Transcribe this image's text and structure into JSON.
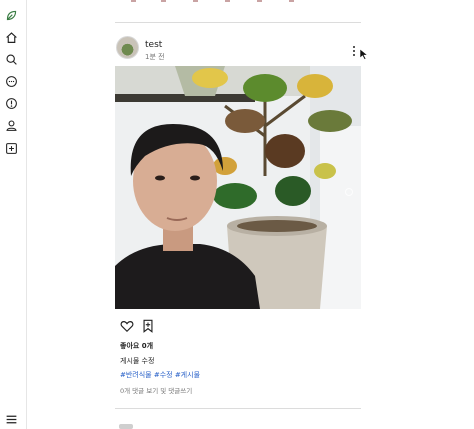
{
  "sidebar": {
    "items": [
      {
        "icon": "leaf-logo-icon"
      },
      {
        "icon": "home-icon"
      },
      {
        "icon": "search-icon"
      },
      {
        "icon": "chat-icon"
      },
      {
        "icon": "notification-icon"
      },
      {
        "icon": "profile-icon"
      },
      {
        "icon": "new-post-icon"
      }
    ],
    "menu_icon": "menu-icon"
  },
  "post": {
    "username": "test",
    "time": "1분 전",
    "likes": "좋아요 0개",
    "caption": "게시물 수정",
    "hashtags": "#반려식물 #수정 #게시물",
    "comments_link": "0개 댓글 보기 및 댓글쓰기"
  },
  "colors": {
    "accent_link": "#2a62c9",
    "logo_green": "#3a7d44",
    "divider": "#dcdcdc"
  }
}
